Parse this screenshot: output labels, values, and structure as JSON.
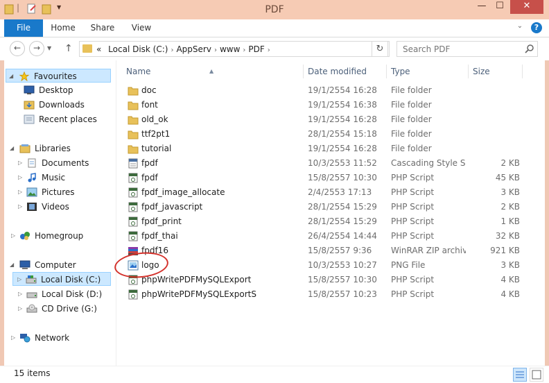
{
  "window": {
    "title": "PDF",
    "minimize": "—",
    "maximize": "☐",
    "close": "✕"
  },
  "ribbon": {
    "tabs": [
      "File",
      "Home",
      "Share",
      "View"
    ],
    "help": "?"
  },
  "address": {
    "prefix": "«",
    "crumbs": [
      "Local Disk (C:)",
      "AppServ",
      "www",
      "PDF"
    ]
  },
  "search": {
    "placeholder": "Search PDF"
  },
  "nav": {
    "favourites": {
      "label": "Favourites",
      "items": [
        "Desktop",
        "Downloads",
        "Recent places"
      ]
    },
    "libraries": {
      "label": "Libraries",
      "items": [
        "Documents",
        "Music",
        "Pictures",
        "Videos"
      ]
    },
    "homegroup": "Homegroup",
    "computer": {
      "label": "Computer",
      "items": [
        "Local Disk (C:)",
        "Local Disk (D:)",
        "CD Drive (G:)"
      ]
    },
    "network": "Network"
  },
  "columns": {
    "name": "Name",
    "date": "Date modified",
    "type": "Type",
    "size": "Size"
  },
  "files": [
    {
      "name": "doc",
      "date": "19/1/2554 16:28",
      "type": "File folder",
      "size": "",
      "icon": "folder-icon"
    },
    {
      "name": "font",
      "date": "19/1/2554 16:38",
      "type": "File folder",
      "size": "",
      "icon": "folder-icon"
    },
    {
      "name": "old_ok",
      "date": "19/1/2554 16:28",
      "type": "File folder",
      "size": "",
      "icon": "folder-icon"
    },
    {
      "name": "ttf2pt1",
      "date": "28/1/2554 15:18",
      "type": "File folder",
      "size": "",
      "icon": "folder-icon"
    },
    {
      "name": "tutorial",
      "date": "19/1/2554 16:28",
      "type": "File folder",
      "size": "",
      "icon": "folder-icon"
    },
    {
      "name": "fpdf",
      "date": "10/3/2553 11:52",
      "type": "Cascading Style S...",
      "size": "2 KB",
      "icon": "css-file-icon"
    },
    {
      "name": "fpdf",
      "date": "15/8/2557 10:30",
      "type": "PHP Script",
      "size": "45 KB",
      "icon": "php-file-icon"
    },
    {
      "name": "fpdf_image_allocate",
      "date": "2/4/2553 17:13",
      "type": "PHP Script",
      "size": "3 KB",
      "icon": "php-file-icon"
    },
    {
      "name": "fpdf_javascript",
      "date": "28/1/2554 15:29",
      "type": "PHP Script",
      "size": "2 KB",
      "icon": "php-file-icon"
    },
    {
      "name": "fpdf_print",
      "date": "28/1/2554 15:29",
      "type": "PHP Script",
      "size": "1 KB",
      "icon": "php-file-icon"
    },
    {
      "name": "fpdf_thai",
      "date": "26/4/2554 14:44",
      "type": "PHP Script",
      "size": "32 KB",
      "icon": "php-file-icon"
    },
    {
      "name": "fpdf16",
      "date": "15/8/2557 9:36",
      "type": "WinRAR ZIP archive",
      "size": "921 KB",
      "icon": "zip-file-icon"
    },
    {
      "name": "logo",
      "date": "10/3/2553 10:27",
      "type": "PNG File",
      "size": "3 KB",
      "icon": "image-file-icon"
    },
    {
      "name": "phpWritePDFMySQLExport",
      "date": "15/8/2557 10:30",
      "type": "PHP Script",
      "size": "4 KB",
      "icon": "php-file-icon"
    },
    {
      "name": "phpWritePDFMySQLExportS",
      "date": "15/8/2557 10:23",
      "type": "PHP Script",
      "size": "4 KB",
      "icon": "php-file-icon"
    }
  ],
  "status": {
    "items": "15 items"
  },
  "colors": {
    "accent": "#1979ca",
    "selection": "#cce8ff",
    "annotation": "#d4322c",
    "folder": "#e8c15a"
  }
}
